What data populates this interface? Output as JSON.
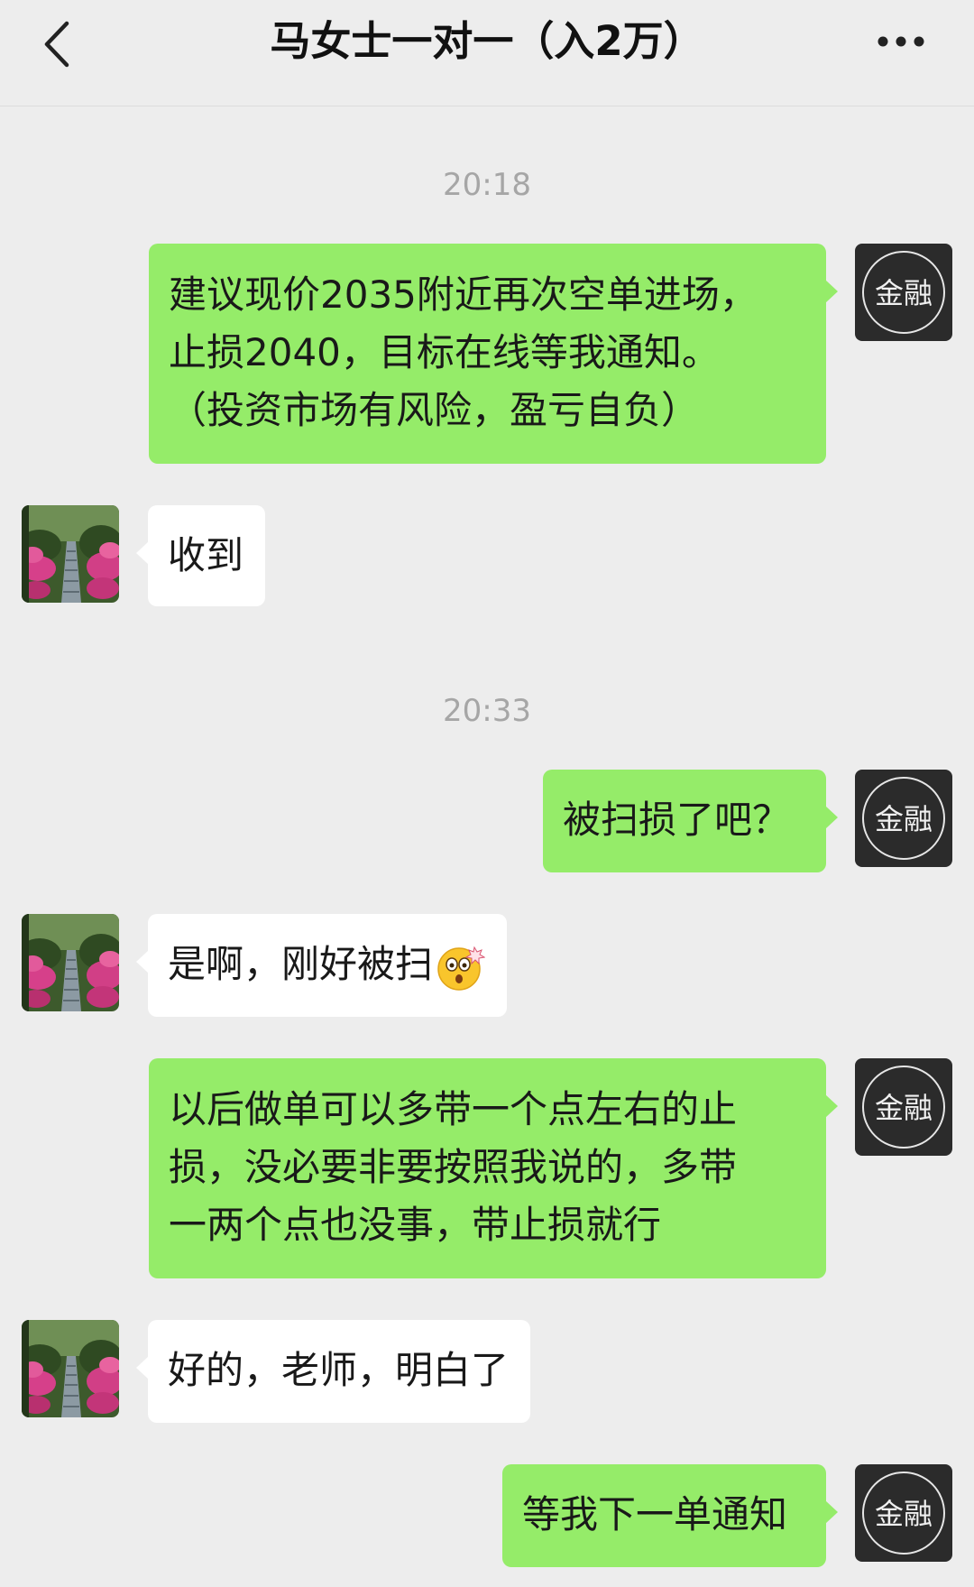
{
  "header": {
    "title": "马女士一对一（入2万）",
    "back_icon": "chevron-left-icon",
    "more_icon": "more-dots-icon"
  },
  "self_avatar_text": "金融",
  "colors": {
    "outgoing_bubble": "#95ec69",
    "incoming_bubble": "#ffffff",
    "background": "#ededed"
  },
  "messages": {
    "t1": "20:18",
    "m1": {
      "lines": [
        "建议现价2035附近再次空单进场，",
        "止损2040，目标在线等我通知。",
        "（投资市场有风险，盈亏自负）"
      ]
    },
    "m2": {
      "text": "收到"
    },
    "t2": "20:33",
    "m3": {
      "text": "被扫损了吧？"
    },
    "m4": {
      "text": "是啊，刚好被扫",
      "emoji": "shocked-face-emoji"
    },
    "m5": {
      "lines": [
        "以后做单可以多带一个点左右的止",
        "损，没必要非要按照我说的，多带",
        "一两个点也没事，带止损就行"
      ]
    },
    "m6": {
      "text": "好的，老师，明白了"
    },
    "m7": {
      "text": "等我下一单通知"
    }
  }
}
